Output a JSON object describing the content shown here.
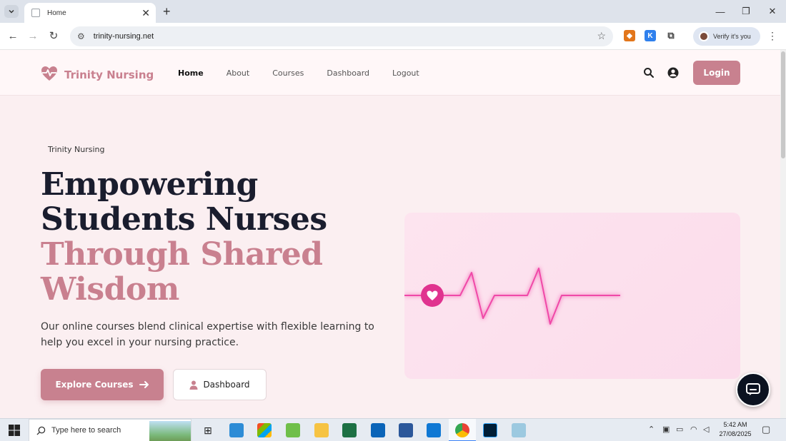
{
  "browser": {
    "tab_title": "Home",
    "url": "trinity-nursing.net",
    "profile_label": "Verify it's you"
  },
  "site": {
    "brand": "Trinity Nursing",
    "nav": [
      {
        "label": "Home",
        "active": true
      },
      {
        "label": "About",
        "active": false
      },
      {
        "label": "Courses",
        "active": false
      },
      {
        "label": "Dashboard",
        "active": false
      },
      {
        "label": "Logout",
        "active": false
      }
    ],
    "login_label": "Login",
    "hero": {
      "eyebrow": "Trinity Nursing",
      "headline_line1": "Empowering",
      "headline_line2": "Students Nurses",
      "headline_line3": "Through Shared",
      "headline_line4": "Wisdom",
      "lead": "Our online courses blend clinical expertise with flexible learning to help you excel in your nursing practice.",
      "primary_cta": "Explore Courses",
      "secondary_cta": "Dashboard"
    },
    "colors": {
      "accent": "#c8818f",
      "heading": "#1a1d2e",
      "ecg": "#f04aa8",
      "chat": "#0b1220"
    }
  },
  "taskbar": {
    "search_placeholder": "Type here to search",
    "time": "5:42 AM",
    "date": "27/08/2025"
  }
}
